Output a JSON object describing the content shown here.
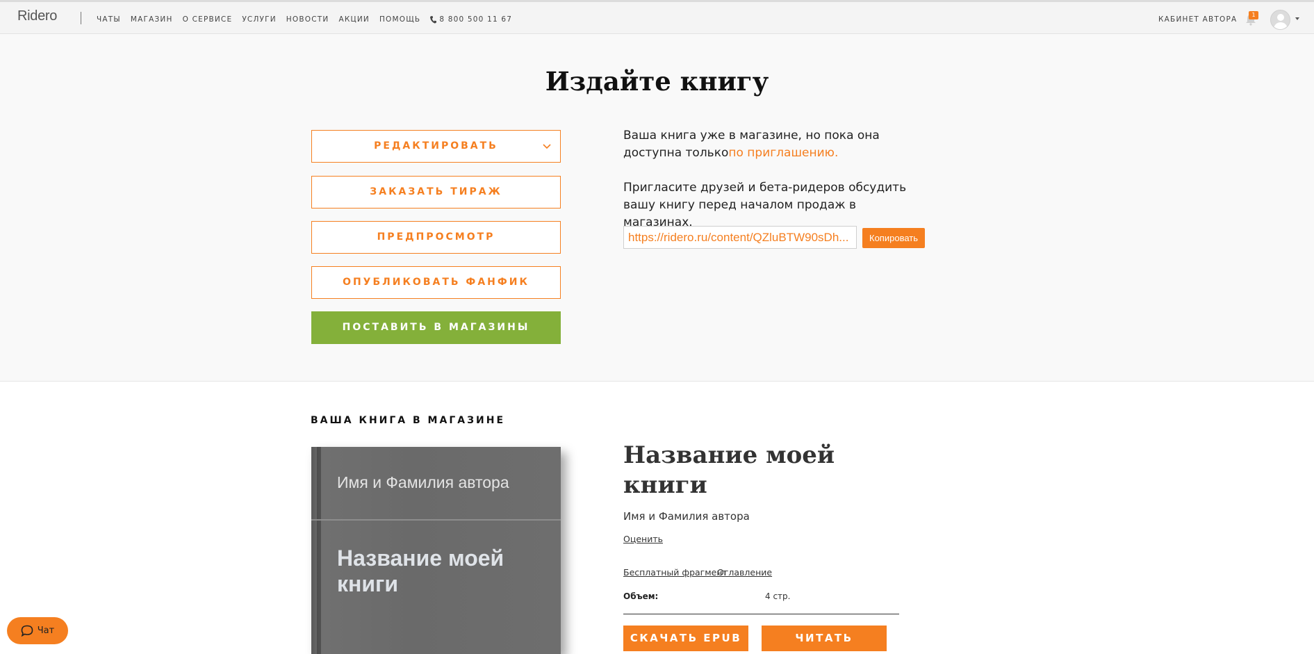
{
  "header": {
    "logo": "Ridero",
    "nav": [
      "ЧАТЫ",
      "МАГАЗИН",
      "О СЕРВИСЕ",
      "УСЛУГИ",
      "НОВОСТИ",
      "АКЦИИ",
      "ПОМОЩЬ"
    ],
    "phone": "8 800 500 11 67",
    "cabinet": "КАБИНЕТ АВТОРА",
    "notifications_count": "1"
  },
  "hero": {
    "title": "Издайте книгу",
    "buttons": {
      "edit": "РЕДАКТИРОВАТЬ",
      "order": "ЗАКАЗАТЬ ТИРАЖ",
      "preview": "ПРЕДПРОСМОТР",
      "fanfic": "ОПУБЛИКОВАТЬ ФАНФИК",
      "stores": "ПОСТАВИТЬ В МАГАЗИНЫ"
    },
    "status_text": "Ваша книга уже в магазине, но пока она доступна только",
    "status_link": "по приглашению.",
    "invite_text": "Пригласите друзей и бета-ридеров обсудить вашу книгу перед началом продаж в магазинах.",
    "invite_link": "https://ridero.ru/content/QZluBTW90sDh...",
    "copy_label": "Копировать"
  },
  "book": {
    "section_label": "ВАША КНИГА В МАГАЗИНЕ",
    "cover_author": "Имя и Фамилия автора",
    "cover_title": "Название моей книги",
    "title": "Название моей книги",
    "author": "Имя и Фамилия автора",
    "rate_link": "Оценить",
    "fragment_link": "Бесплатный фрагмент",
    "toc_link": "Оглавление",
    "volume_label": "Объем:",
    "volume_value": "4 стр.",
    "download_label": "СКАЧАТЬ EPUB",
    "read_label": "ЧИТАТЬ"
  },
  "chat": {
    "label": "Чат"
  },
  "colors": {
    "accent": "#f57f20",
    "green": "#84b03a"
  }
}
